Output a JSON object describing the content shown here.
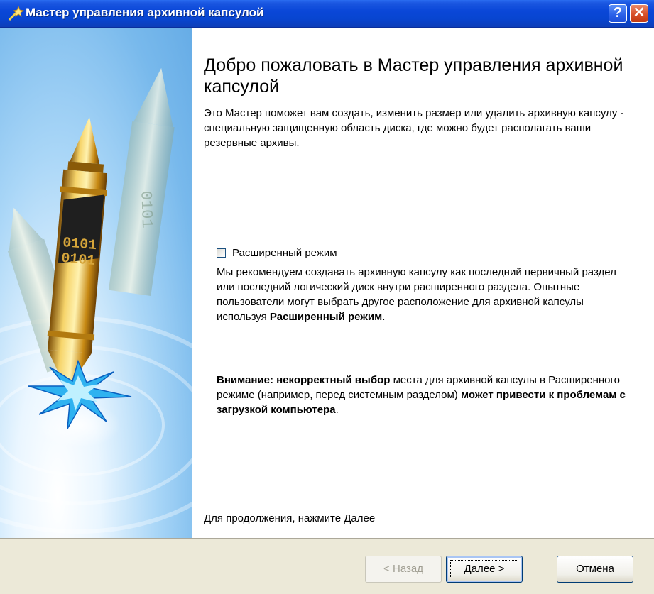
{
  "window": {
    "title": "Мастер управления архивной капсулой",
    "help_glyph": "?",
    "close_glyph": "✕"
  },
  "content": {
    "heading": "Добро пожаловать в Мастер управления архивной капсулой",
    "intro": "Это Мастер поможет вам создать, изменить размер или удалить архивную капсулу - специальную защищенную область диска, где можно будет располагать ваши резервные архивы.",
    "advanced_mode": {
      "label": "Расширенный режим",
      "checked": false
    },
    "recommendation": {
      "text": "Мы рекомендуем создавать архивную капсулу как последний первичный раздел или последний логический диск внутри расширенного раздела. Опытные пользователи могут выбрать другое расположение для архивной капсулы используя ",
      "bold": "Расширенный режим",
      "end": "."
    },
    "warning": {
      "bold_start": "Внимание: некорректный выбор",
      "middle": " места для архивной капсулы в Расширенного режиме (например, перед системным разделом) ",
      "bold_end": "может привести к проблемам с загрузкой компьютера",
      "end": "."
    },
    "continue_hint": "Для продолжения, нажмите Далее"
  },
  "side_panel": {
    "image": "archive-capsule-pillar-illustration",
    "binary_text": "0101"
  },
  "buttons": {
    "back": {
      "prefix": "< ",
      "mnemonic": "Н",
      "rest": "азад",
      "enabled": false
    },
    "next": {
      "mnemonic": "Д",
      "rest": "алее >",
      "enabled": true
    },
    "cancel": {
      "prefix": "О",
      "mnemonic": "т",
      "rest": "мена",
      "enabled": true
    }
  },
  "colors": {
    "titlebar": "#0a47d8",
    "dialog_bg": "#ece9d8",
    "panel_blue": "#66ace6",
    "gold": "#d7a52a"
  }
}
